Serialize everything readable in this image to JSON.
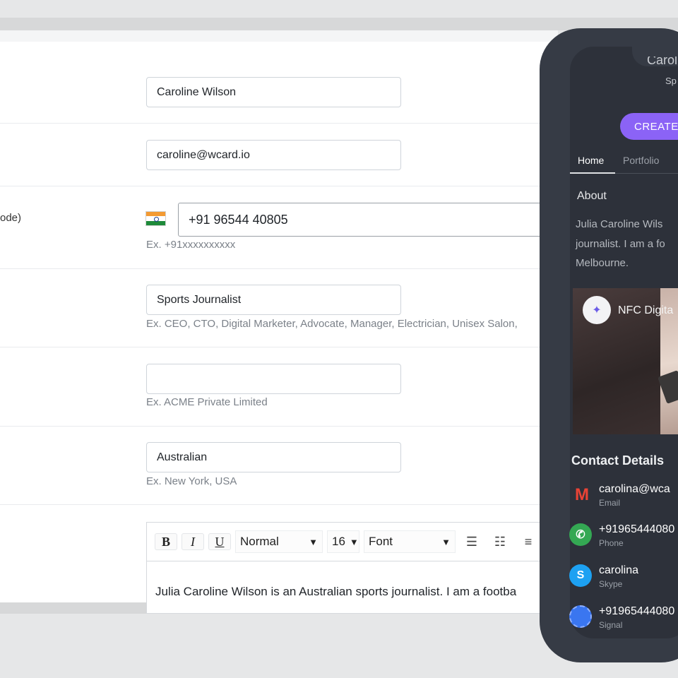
{
  "form": {
    "name": {
      "value": "Caroline Wilson"
    },
    "email": {
      "value": "caroline@wcard.io"
    },
    "phone": {
      "label": "ode)",
      "value": "+91 96544 40805",
      "hint": "Ex. +91xxxxxxxxxx"
    },
    "designation": {
      "value": "Sports Journalist",
      "hint": "Ex. CEO, CTO, Digital Marketer, Advocate, Manager, Electrician, Unisex Salon,"
    },
    "company": {
      "value": "",
      "hint": "Ex. ACME Private Limited"
    },
    "location": {
      "value": "Australian",
      "hint": "Ex. New York, USA"
    },
    "editor": {
      "bold": "B",
      "italic": "I",
      "underline": "U",
      "style_select": "Normal",
      "size_select": "16",
      "font_select": "Font",
      "bullet_list_icon": "☰",
      "ordered_list_icon": "☷",
      "indent_icon": "≡",
      "caret": "▼",
      "body": "Julia Caroline Wilson is an Australian sports journalist. I am a footba"
    }
  },
  "phone": {
    "header_name": "Caroline",
    "header_sub": "Sp",
    "create_button": "CREATE",
    "tabs": [
      "Home",
      "Portfolio"
    ],
    "about_title": "About",
    "about_text": "Julia Caroline Wils\njournalist. I am a fo\nMelbourne.",
    "video": {
      "logo_text": "✦",
      "title": "NFC Digita"
    },
    "contact_title": "Contact Details",
    "contacts": [
      {
        "value": "carolina@wca",
        "type": "Email",
        "icon": "gmail-icon",
        "glyph": "M",
        "color": "#ea4335"
      },
      {
        "value": "+91965444080",
        "type": "Phone",
        "icon": "phone-icon",
        "glyph": "✆",
        "color": "#34a853"
      },
      {
        "value": "carolina",
        "type": "Skype",
        "icon": "skype-icon",
        "glyph": "S",
        "color": "#1da1f2"
      },
      {
        "value": "+91965444080",
        "type": "Signal",
        "icon": "signal-icon",
        "glyph": "",
        "color": "#3a76f0"
      }
    ]
  }
}
